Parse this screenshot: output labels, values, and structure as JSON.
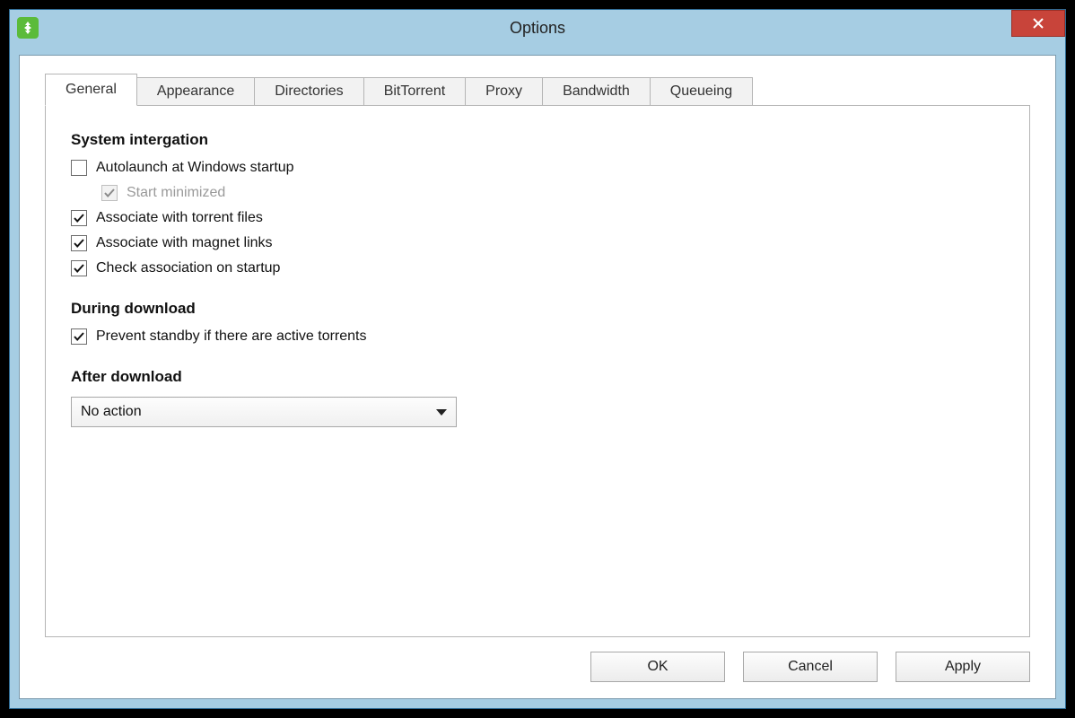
{
  "window": {
    "title": "Options"
  },
  "tabs": [
    {
      "label": "General",
      "active": true
    },
    {
      "label": "Appearance",
      "active": false
    },
    {
      "label": "Directories",
      "active": false
    },
    {
      "label": "BitTorrent",
      "active": false
    },
    {
      "label": "Proxy",
      "active": false
    },
    {
      "label": "Bandwidth",
      "active": false
    },
    {
      "label": "Queueing",
      "active": false
    }
  ],
  "sections": {
    "system_integration": {
      "title": "System intergation",
      "autolaunch": {
        "label": "Autolaunch at Windows startup",
        "checked": false,
        "disabled": false
      },
      "start_minimized": {
        "label": "Start minimized",
        "checked": true,
        "disabled": true
      },
      "assoc_torrent": {
        "label": "Associate with torrent files",
        "checked": true,
        "disabled": false
      },
      "assoc_magnet": {
        "label": "Associate with magnet links",
        "checked": true,
        "disabled": false
      },
      "check_assoc": {
        "label": "Check association on startup",
        "checked": true,
        "disabled": false
      }
    },
    "during_download": {
      "title": "During download",
      "prevent_standby": {
        "label": "Prevent standby if there are active torrents",
        "checked": true,
        "disabled": false
      }
    },
    "after_download": {
      "title": "After download",
      "action_selected": "No action"
    }
  },
  "buttons": {
    "ok": "OK",
    "cancel": "Cancel",
    "apply": "Apply"
  }
}
